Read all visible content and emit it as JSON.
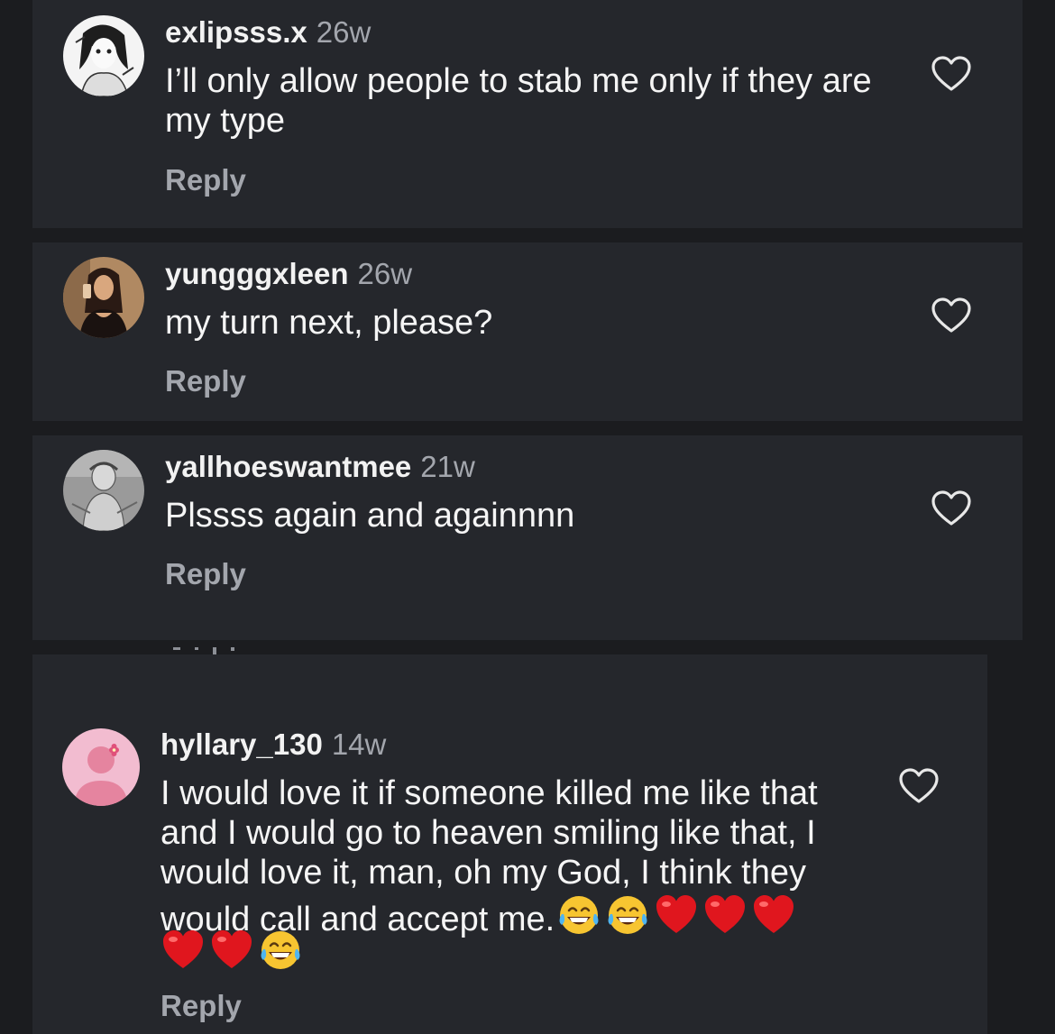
{
  "comments": [
    {
      "username": "exlipsss.x",
      "time": "26w",
      "text": "I’ll only allow people to stab me only if they are my type",
      "reply_label": "Reply",
      "avatar_icon": "anime-girl-sketch-avatar",
      "like_icon": "heart-outline-icon"
    },
    {
      "username": "yungggxleen",
      "time": "26w",
      "text": "my turn next, please?",
      "reply_label": "Reply",
      "avatar_icon": "selfie-girl-avatar",
      "like_icon": "heart-outline-icon"
    },
    {
      "username": "yallhoeswantmee",
      "time": "21w",
      "text": "Plssss again and againnnn",
      "reply_label": "Reply",
      "avatar_icon": "grey-sketch-avatar",
      "like_icon": "heart-outline-icon"
    },
    {
      "username": "hyllary_130",
      "time": "14w",
      "text": "I would love it if someone killed me like that and I would go to heaven smiling like that, I would love it, man, oh my God, I think they would call and accept me.",
      "emojis_inline": [
        "😂",
        "😂",
        "❤️",
        "❤️",
        "❤️"
      ],
      "emojis_line2": [
        "❤️",
        "❤️",
        "😂"
      ],
      "reply_label": "Reply",
      "avatar_icon": "default-pink-person-avatar",
      "like_icon": "heart-outline-icon"
    }
  ],
  "colors": {
    "background": "#1b1c1f",
    "card": "#25272c",
    "username": "#f2f2f2",
    "text": "#f5f5f5",
    "secondary": "#a3a6ad"
  }
}
